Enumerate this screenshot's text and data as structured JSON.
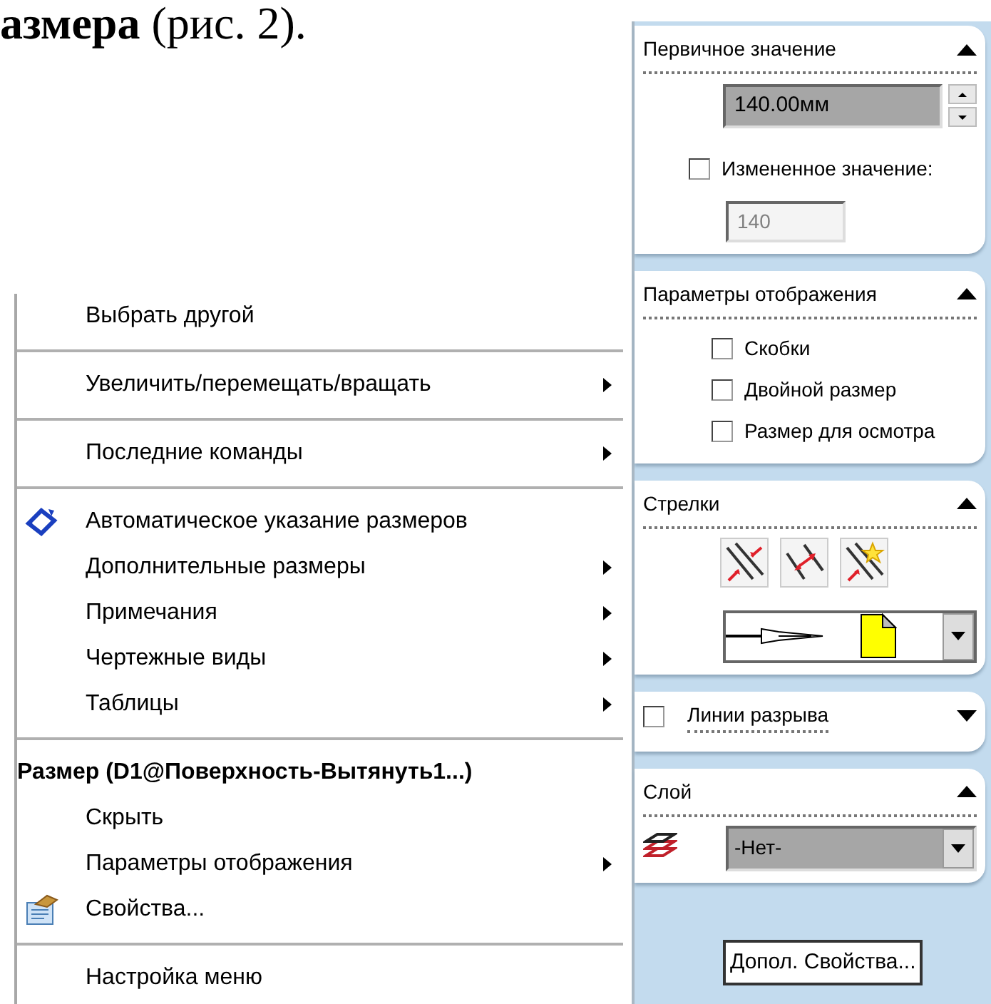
{
  "heading": "**азмера** (рис. 2).",
  "context_menu": {
    "items": [
      {
        "kind": "item",
        "label": "Выбрать другой",
        "submenu": false
      },
      {
        "kind": "separator"
      },
      {
        "kind": "item",
        "label": "Увеличить/перемещать/вращать",
        "submenu": true
      },
      {
        "kind": "separator"
      },
      {
        "kind": "item",
        "label": "Последние команды",
        "submenu": true
      },
      {
        "kind": "separator"
      },
      {
        "kind": "item",
        "label": "Автоматическое указание размеров",
        "submenu": false,
        "has_icon": true
      },
      {
        "kind": "item",
        "label": "Дополнительные размеры",
        "submenu": true
      },
      {
        "kind": "item",
        "label": "Примечания",
        "submenu": true
      },
      {
        "kind": "item",
        "label": "Чертежные виды",
        "submenu": true
      },
      {
        "kind": "item",
        "label": "Таблицы",
        "submenu": true
      },
      {
        "kind": "separator"
      },
      {
        "kind": "header",
        "label": "Размер (D1@Поверхность-Вытянуть1...)"
      },
      {
        "kind": "item",
        "label": "Скрыть",
        "submenu": false
      },
      {
        "kind": "item",
        "label": "Параметры отображения",
        "submenu": true
      },
      {
        "kind": "item",
        "label": "Свойства...",
        "submenu": false,
        "has_icon": true
      },
      {
        "kind": "separator"
      },
      {
        "kind": "item",
        "label": "Настройка меню",
        "submenu": false
      }
    ]
  },
  "property_panel": {
    "groups": [
      {
        "kind": "value",
        "title": "Первичное значение",
        "expanded": true,
        "value": "140.00мм",
        "override": {
          "label": "Измененное значение:",
          "checked": false
        },
        "override_value": {
          "value": "140",
          "disabled": true
        }
      },
      {
        "kind": "options",
        "title": "Параметры отображения",
        "expanded": true,
        "options": [
          {
            "label": "Скобки",
            "checked": false
          },
          {
            "label": "Двойной размер",
            "checked": false
          },
          {
            "label": "Размер для осмотра",
            "checked": false
          }
        ]
      },
      {
        "kind": "arrows",
        "title": "Стрелки",
        "expanded": true
      },
      {
        "kind": "toggle",
        "title": "Линии разрыва",
        "checked": false,
        "expanded": false
      },
      {
        "kind": "layer",
        "title": "Слой",
        "expanded": true,
        "value": "-Нет-"
      }
    ],
    "button": "Допол. Свойства..."
  }
}
